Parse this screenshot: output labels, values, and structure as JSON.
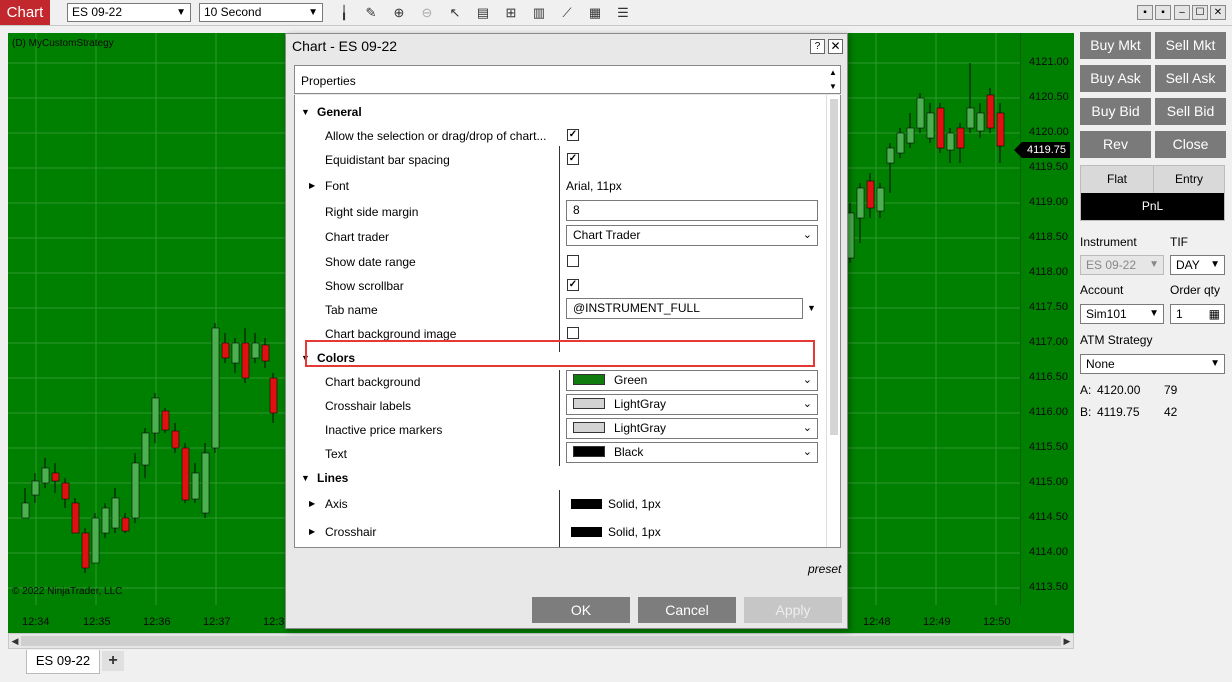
{
  "toolbar": {
    "app_tab": "Chart",
    "instrument": "ES 09-22",
    "interval": "10 Second",
    "icons": [
      "bars-icon",
      "pencil-icon",
      "zoom-in-icon",
      "zoom-out-icon",
      "pointer-icon",
      "data-box-icon",
      "strategies-icon",
      "indicators-icon",
      "drawing-tool-icon",
      "templates-icon",
      "properties-icon"
    ]
  },
  "chart": {
    "strategy_label": "(D) MyCustomStrategy",
    "copyright": "© 2022 NinjaTrader, LLC",
    "background_color": "#008000",
    "current_price": "4119.75",
    "price_ticks": [
      "4121.00",
      "4120.50",
      "4120.00",
      "4119.50",
      "4119.00",
      "4118.50",
      "4118.00",
      "4117.50",
      "4117.00",
      "4116.50",
      "4116.00",
      "4115.50",
      "4115.00",
      "4114.50",
      "4114.00",
      "4113.50"
    ],
    "time_ticks": [
      "12:34",
      "12:35",
      "12:36",
      "12:37",
      "12:3",
      "12:48",
      "12:49",
      "12:50"
    ]
  },
  "bottom": {
    "tab_label": "ES 09-22",
    "add_label": "+"
  },
  "chart_trader": {
    "buttons": [
      "Buy Mkt",
      "Sell Mkt",
      "Buy Ask",
      "Sell Ask",
      "Buy Bid",
      "Sell Bid",
      "Rev",
      "Close"
    ],
    "position": {
      "flat": "Flat",
      "entry": "Entry",
      "pnl": "PnL"
    },
    "instrument_label": "Instrument",
    "instrument_value": "ES 09-22",
    "tif_label": "TIF",
    "tif_value": "DAY",
    "account_label": "Account",
    "account_value": "Sim101",
    "qty_label": "Order qty",
    "qty_value": "1",
    "atm_label": "ATM Strategy",
    "atm_value": "None",
    "ask_label": "A:",
    "ask_price": "4120.00",
    "ask_size": "79",
    "bid_label": "B:",
    "bid_price": "4119.75",
    "bid_size": "42"
  },
  "dialog": {
    "title": "Chart - ES 09-22",
    "help": "?",
    "close": "✕",
    "properties_header": "Properties",
    "general": {
      "label": "General",
      "allow_selection": "Allow the selection or drag/drop of chart...",
      "equidistant": "Equidistant bar spacing",
      "font": "Font",
      "font_value": "Arial, 11px",
      "right_margin": "Right side margin",
      "right_margin_value": "8",
      "chart_trader": "Chart trader",
      "chart_trader_value": "Chart Trader",
      "show_date_range": "Show date range",
      "show_scrollbar": "Show scrollbar",
      "tab_name": "Tab name",
      "tab_name_value": "@INSTRUMENT_FULL",
      "bg_image": "Chart background image"
    },
    "colors": {
      "label": "Colors",
      "chart_background": "Chart background",
      "chart_background_value": "Green",
      "crosshair_labels": "Crosshair labels",
      "crosshair_labels_value": "LightGray",
      "inactive_price": "Inactive price markers",
      "inactive_price_value": "LightGray",
      "text": "Text",
      "text_value": "Black"
    },
    "lines": {
      "label": "Lines",
      "axis": "Axis",
      "axis_value": "Solid, 1px",
      "crosshair": "Crosshair",
      "crosshair_value": "Solid, 1px"
    },
    "preset": "preset",
    "ok": "OK",
    "cancel": "Cancel",
    "apply": "Apply",
    "swatch_colors": {
      "green": "#107c10",
      "lightgray": "#d3d3d3",
      "black": "#000000"
    }
  }
}
